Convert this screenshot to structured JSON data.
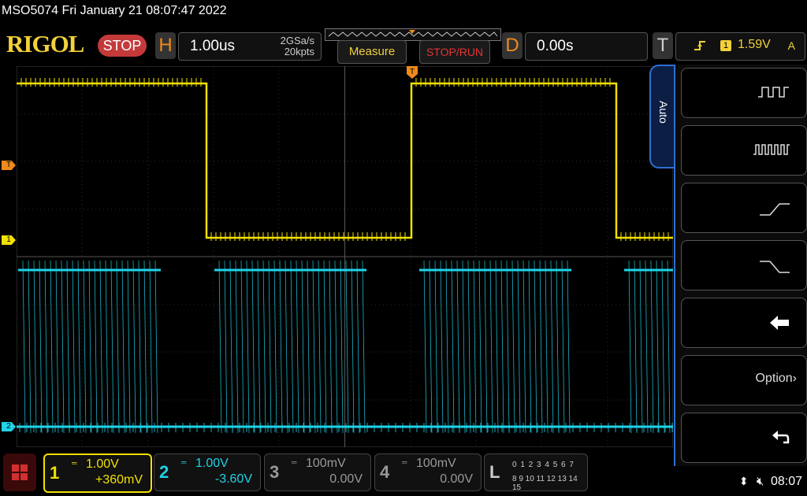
{
  "header": {
    "title": "MSO5074  Fri January 21 08:07:47 2022",
    "brand": "RIGOL",
    "run_state": "STOP"
  },
  "horizontal": {
    "label": "H",
    "scale": "1.00us",
    "sample_rate": "2GSa/s",
    "memory_depth": "20kpts"
  },
  "toolbar": {
    "measure_label": "Measure",
    "stoprun_label": "STOP/RUN"
  },
  "delay": {
    "label": "D",
    "value": "0.00s"
  },
  "trigger": {
    "label": "T",
    "slope_icon": "rising-edge-icon",
    "source": "1",
    "level": "1.59V",
    "mode": "A"
  },
  "side_menu": {
    "tab_label": "Auto",
    "items": [
      {
        "icon": "single-pulse-icon"
      },
      {
        "icon": "pulse-train-icon"
      },
      {
        "icon": "rising-edge-icon"
      },
      {
        "icon": "falling-edge-icon"
      },
      {
        "icon": "back-arrow-icon"
      },
      {
        "label": "Option"
      },
      {
        "icon": "undo-icon"
      }
    ]
  },
  "markers": {
    "trigger_level": "T",
    "ch1": "1",
    "ch2": "2"
  },
  "channels": [
    {
      "num": "1",
      "scale": "1.00V",
      "offset": "+360mV",
      "color": "#f2e000",
      "active": true
    },
    {
      "num": "2",
      "scale": "1.00V",
      "offset": "-3.60V",
      "color": "#1fd3e8",
      "active": false
    },
    {
      "num": "3",
      "scale": "100mV",
      "offset": "0.00V",
      "color": "#888888",
      "active": false
    },
    {
      "num": "4",
      "scale": "100mV",
      "offset": "0.00V",
      "color": "#888888",
      "active": false
    }
  ],
  "logic": {
    "label": "L",
    "row1": "0 1 2 3   4 5 6 7",
    "row2": "8 9 10 11 12 13 14 15"
  },
  "status": {
    "time": "08:07",
    "usb_icon": "usb-icon",
    "mute_icon": "speaker-muted-icon"
  },
  "colors": {
    "ch1": "#f2e000",
    "ch2": "#1fd3e8",
    "accent": "#2f6fd0",
    "stop": "#c43a3a",
    "brand": "#f2d13a"
  }
}
